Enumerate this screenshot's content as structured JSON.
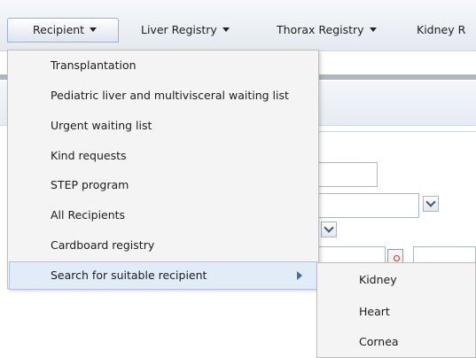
{
  "menubar": {
    "items": [
      {
        "label": "Recipient"
      },
      {
        "label": "Liver Registry"
      },
      {
        "label": "Thorax Registry"
      },
      {
        "label": "Kidney R"
      }
    ]
  },
  "recipient_menu": {
    "items": [
      {
        "label": "Transplantation"
      },
      {
        "label": "Pediatric liver and multivisceral waiting list"
      },
      {
        "label": "Urgent waiting list"
      },
      {
        "label": "Kind requests"
      },
      {
        "label": "STEP program"
      },
      {
        "label": "All Recipients"
      },
      {
        "label": "Cardboard registry"
      },
      {
        "label": "Search for suitable recipient",
        "icon": "chevron-right-icon",
        "highlighted": true
      }
    ]
  },
  "submenu": {
    "items": [
      {
        "label": "Kidney"
      },
      {
        "label": "Heart"
      },
      {
        "label": "Cornea"
      }
    ]
  }
}
